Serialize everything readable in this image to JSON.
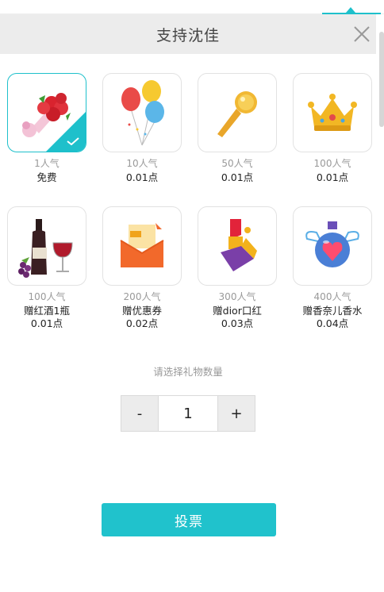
{
  "header": {
    "title": "支持沈佳"
  },
  "gifts": [
    {
      "popularity": "1人气",
      "name": "免费",
      "price": "",
      "icon": "bouquet-icon",
      "selected": true
    },
    {
      "popularity": "10人气",
      "name": "0.01点",
      "price": "",
      "icon": "balloons-icon",
      "selected": false
    },
    {
      "popularity": "50人气",
      "name": "0.01点",
      "price": "",
      "icon": "microphone-icon",
      "selected": false
    },
    {
      "popularity": "100人气",
      "name": "0.01点",
      "price": "",
      "icon": "crown-icon",
      "selected": false
    },
    {
      "popularity": "100人气",
      "name": "赠红酒1瓶",
      "price": "0.01点",
      "icon": "wine-icon",
      "selected": false
    },
    {
      "popularity": "200人气",
      "name": "赠优惠券",
      "price": "0.02点",
      "icon": "coupon-icon",
      "selected": false
    },
    {
      "popularity": "300人气",
      "name": "赠dior口红",
      "price": "0.03点",
      "icon": "lipstick-icon",
      "selected": false
    },
    {
      "popularity": "400人气",
      "name": "赠香奈儿香水",
      "price": "0.04点",
      "icon": "perfume-icon",
      "selected": false
    }
  ],
  "quantity": {
    "label": "请选择礼物数量",
    "minus": "-",
    "value": "1",
    "plus": "+"
  },
  "vote_button": "投票",
  "colors": {
    "accent": "#1ec0cb",
    "header_bg": "#ececec"
  }
}
